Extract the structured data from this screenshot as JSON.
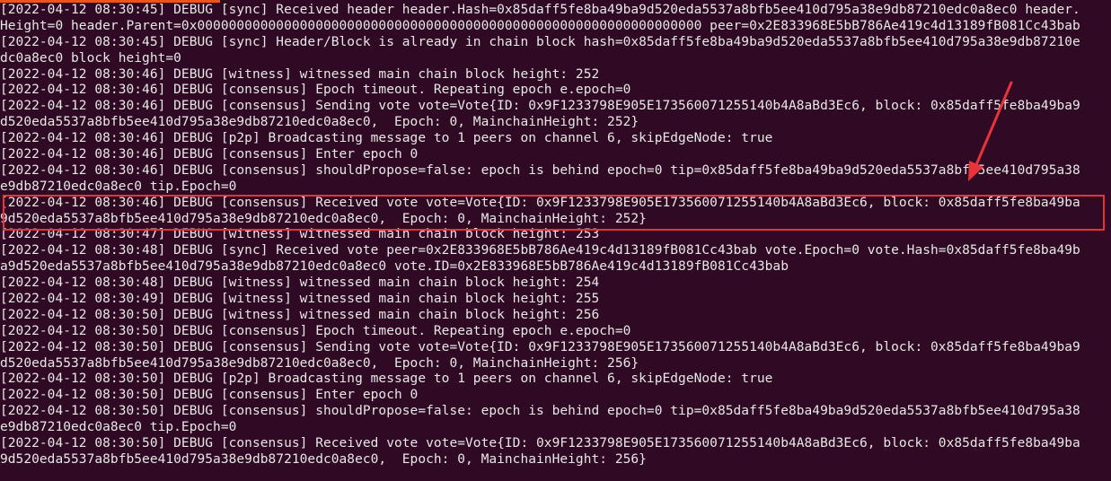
{
  "terminal": {
    "lines": [
      "[2022-04-12 08:30:45] DEBUG [sync] Received header header.Hash=0x85daff5fe8ba49ba9d520eda5537a8bfb5ee410d795a38e9db87210edc0a8ec0 header.",
      "Height=0 header.Parent=0x0000000000000000000000000000000000000000000000000000000000000000 peer=0x2E833968E5bB786Ae419c4d13189fB081Cc43bab",
      "[2022-04-12 08:30:45] DEBUG [sync] Header/Block is already in chain block hash=0x85daff5fe8ba49ba9d520eda5537a8bfb5ee410d795a38e9db87210e",
      "dc0a8ec0 block height=0",
      "[2022-04-12 08:30:46] DEBUG [witness] witnessed main chain block height: 252",
      "[2022-04-12 08:30:46] DEBUG [consensus] Epoch timeout. Repeating epoch e.epoch=0",
      "[2022-04-12 08:30:46] DEBUG [consensus] Sending vote vote=Vote{ID: 0x9F1233798E905E173560071255140b4A8aBd3Ec6, block: 0x85daff5fe8ba49ba9",
      "d520eda5537a8bfb5ee410d795a38e9db87210edc0a8ec0,  Epoch: 0, MainchainHeight: 252}",
      "[2022-04-12 08:30:46] DEBUG [p2p] Broadcasting message to 1 peers on channel 6, skipEdgeNode: true",
      "[2022-04-12 08:30:46] DEBUG [consensus] Enter epoch 0",
      "[2022-04-12 08:30:46] DEBUG [consensus] shouldPropose=false: epoch is behind epoch=0 tip=0x85daff5fe8ba49ba9d520eda5537a8bfb5ee410d795a38",
      "e9db87210edc0a8ec0 tip.Epoch=0",
      "[2022-04-12 08:30:46] DEBUG [consensus] Received vote vote=Vote{ID: 0x9F1233798E905E173560071255140b4A8aBd3Ec6, block: 0x85daff5fe8ba49ba",
      "9d520eda5537a8bfb5ee410d795a38e9db87210edc0a8ec0,  Epoch: 0, MainchainHeight: 252}",
      "[2022-04-12 08:30:47] DEBUG [witness] witnessed main chain block height: 253",
      "[2022-04-12 08:30:48] DEBUG [sync] Received vote peer=0x2E833968E5bB786Ae419c4d13189fB081Cc43bab vote.Epoch=0 vote.Hash=0x85daff5fe8ba49b",
      "a9d520eda5537a8bfb5ee410d795a38e9db87210edc0a8ec0 vote.ID=0x2E833968E5bB786Ae419c4d13189fB081Cc43bab",
      "[2022-04-12 08:30:48] DEBUG [witness] witnessed main chain block height: 254",
      "[2022-04-12 08:30:49] DEBUG [witness] witnessed main chain block height: 255",
      "[2022-04-12 08:30:50] DEBUG [witness] witnessed main chain block height: 256",
      "[2022-04-12 08:30:50] DEBUG [consensus] Epoch timeout. Repeating epoch e.epoch=0",
      "[2022-04-12 08:30:50] DEBUG [consensus] Sending vote vote=Vote{ID: 0x9F1233798E905E173560071255140b4A8aBd3Ec6, block: 0x85daff5fe8ba49ba9",
      "d520eda5537a8bfb5ee410d795a38e9db87210edc0a8ec0,  Epoch: 0, MainchainHeight: 256}",
      "[2022-04-12 08:30:50] DEBUG [p2p] Broadcasting message to 1 peers on channel 6, skipEdgeNode: true",
      "[2022-04-12 08:30:50] DEBUG [consensus] Enter epoch 0",
      "[2022-04-12 08:30:50] DEBUG [consensus] shouldPropose=false: epoch is behind epoch=0 tip=0x85daff5fe8ba49ba9d520eda5537a8bfb5ee410d795a38",
      "e9db87210edc0a8ec0 tip.Epoch=0",
      "[2022-04-12 08:30:50] DEBUG [consensus] Received vote vote=Vote{ID: 0x9F1233798E905E173560071255140b4A8aBd3Ec6, block: 0x85daff5fe8ba49ba",
      "9d520eda5537a8bfb5ee410d795a38e9db87210edc0a8ec0,  Epoch: 0, MainchainHeight: 256}"
    ]
  },
  "colors": {
    "background": "#300a24",
    "text": "#e7e7e7",
    "annotation": "#e8333a",
    "accent": "#e9541f"
  },
  "annotations": {
    "highlight_icon": "red-highlight-box",
    "arrow_icon": "red-arrow-icon"
  }
}
